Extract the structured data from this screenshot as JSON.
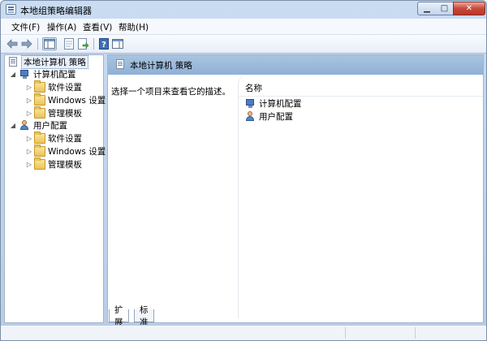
{
  "window": {
    "title": "本地组策略编辑器",
    "controls": {
      "minimize": "▁",
      "maximize": "□",
      "close": "✕"
    }
  },
  "menu": [
    "文件(F)",
    "操作(A)",
    "查看(V)",
    "帮助(H)"
  ],
  "toolbar": {
    "icons": [
      "back-icon",
      "forward-icon",
      "show-hide-tree-icon",
      "properties-icon",
      "export-list-icon",
      "help-icon",
      "show-action-pane-icon"
    ]
  },
  "tree": {
    "root": "本地计算机 策略",
    "computer_config": "计算机配置",
    "user_config": "用户配置",
    "computer_children": [
      "软件设置",
      "Windows 设置",
      "管理模板"
    ],
    "user_children": [
      "软件设置",
      "Windows 设置",
      "管理模板"
    ]
  },
  "right_pane": {
    "header": "本地计算机 策略",
    "description": "选择一个项目来查看它的描述。",
    "column_name": "名称",
    "items": [
      "计算机配置",
      "用户配置"
    ]
  },
  "tabs": [
    "扩展",
    "标准"
  ],
  "colors": {
    "header_blue": "#9dbbdc",
    "title_bar": "#c2d6ef",
    "close_red": "#c7483a"
  }
}
